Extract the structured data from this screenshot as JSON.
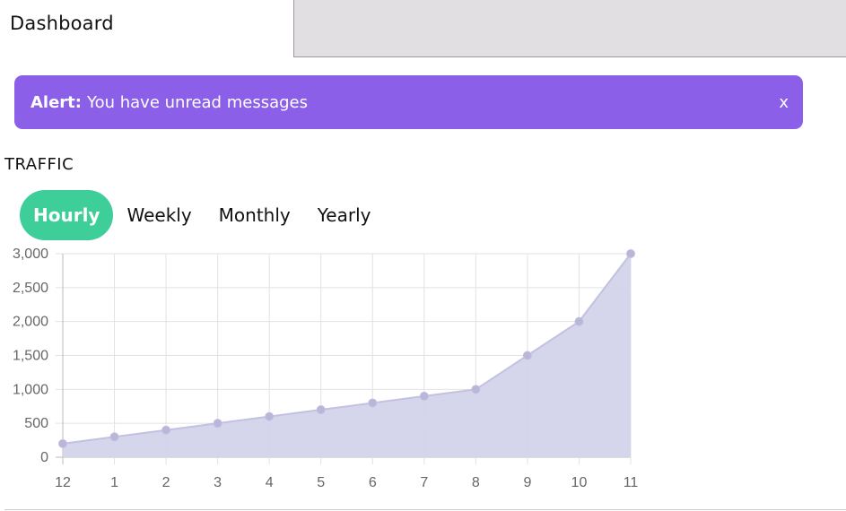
{
  "header": {
    "title": "Dashboard"
  },
  "alert": {
    "prefix": "Alert:",
    "message": "You have unread messages",
    "close_label": "x",
    "background": "#8c5fe8"
  },
  "traffic": {
    "title": "TRAFFIC",
    "tabs": [
      {
        "label": "Hourly",
        "active": true
      },
      {
        "label": "Weekly",
        "active": false
      },
      {
        "label": "Monthly",
        "active": false
      },
      {
        "label": "Yearly",
        "active": false
      }
    ],
    "active_tab_color": "#3dce9a"
  },
  "chart_data": {
    "type": "area",
    "x": [
      "12",
      "1",
      "2",
      "3",
      "4",
      "5",
      "6",
      "7",
      "8",
      "9",
      "10",
      "11"
    ],
    "series": [
      {
        "values": [
          200,
          300,
          400,
          500,
          600,
          700,
          800,
          900,
          1000,
          1500,
          2000,
          3000
        ],
        "fill": "#d3d3ea",
        "stroke": "#c3c1e0",
        "point_color": "#b9b6d9"
      }
    ],
    "y_ticks": [
      "0",
      "500",
      "1,000",
      "1,500",
      "2,000",
      "2,500",
      "3,000"
    ],
    "ylim": [
      0,
      3000
    ],
    "grid": true
  }
}
